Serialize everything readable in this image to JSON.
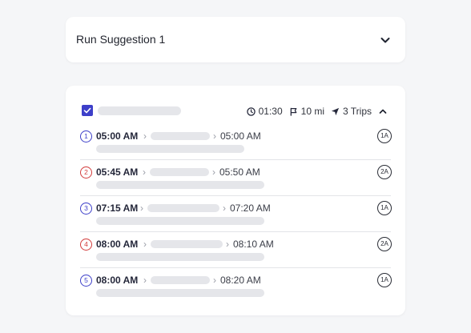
{
  "suggestion": {
    "title": "Run Suggestion 1"
  },
  "run": {
    "checked": true,
    "duration": "01:30",
    "distance": "10 mi",
    "trips": "3 Trips"
  },
  "trips": [
    {
      "num": "1",
      "num_color": "#3d3fc9",
      "start": "05:00 AM",
      "end": "05:00 AM",
      "badge": "1A"
    },
    {
      "num": "2",
      "num_color": "#d23b3b",
      "start": "05:45 AM",
      "end": "05:50 AM",
      "badge": "2A"
    },
    {
      "num": "3",
      "num_color": "#3d3fc9",
      "start": "07:15 AM",
      "end": "07:20 AM",
      "badge": "1A"
    },
    {
      "num": "4",
      "num_color": "#d23b3b",
      "start": "08:00 AM",
      "end": "08:10 AM",
      "badge": "2A"
    },
    {
      "num": "5",
      "num_color": "#3d3fc9",
      "start": "08:00 AM",
      "end": "08:20 AM",
      "badge": "1A"
    }
  ],
  "icons": {
    "expand": "chevron-down-icon",
    "collapse": "chevron-up-icon",
    "duration": "clock-icon",
    "distance": "flag-icon",
    "trips": "navigation-arrow-icon",
    "checkbox": "check-icon"
  },
  "colors": {
    "accent": "#3d3fc9",
    "alert": "#d23b3b"
  }
}
